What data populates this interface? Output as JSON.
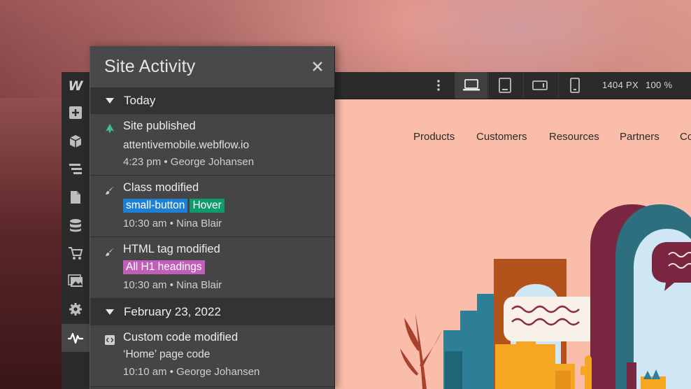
{
  "panel": {
    "title": "Site Activity",
    "sections": [
      {
        "label": "Today",
        "entries": [
          {
            "icon": "publish-icon",
            "title": "Site published",
            "detail": "attentivemobile.webflow.io",
            "meta": "4:23 pm • George Johansen"
          },
          {
            "icon": "brush-icon",
            "title": "Class modified",
            "tags": [
              {
                "text": "small-button",
                "color": "#1f7fd6"
              },
              {
                "text": "Hover",
                "color": "#0f9b6b"
              }
            ],
            "meta": "10:30 am • Nina Blair"
          },
          {
            "icon": "brush-icon",
            "title": "HTML tag modified",
            "tags": [
              {
                "text": "All H1 headings",
                "color": "#c05fb8"
              }
            ],
            "meta": "10:30 am • Nina Blair"
          }
        ]
      },
      {
        "label": "February 23, 2022",
        "entries": [
          {
            "icon": "code-icon",
            "title": "Custom code modified",
            "detail": "‘Home’ page code",
            "meta": "10:10 am • George Johansen"
          }
        ]
      }
    ]
  },
  "toolbar": {
    "width_readout": "1404 PX",
    "zoom_readout": "100 %"
  },
  "canvas": {
    "nav": [
      "Products",
      "Customers",
      "Resources",
      "Partners",
      "Co"
    ]
  },
  "rail": {
    "logo": "W",
    "items": [
      "add-icon",
      "cube-icon",
      "navigator-icon",
      "pages-icon",
      "cms-icon",
      "ecommerce-icon",
      "assets-icon",
      "settings-icon",
      "activity-icon"
    ]
  },
  "colors": {
    "canvas_bg": "#f9bda9",
    "publish_accent": "#3fbf8a",
    "tag_class": "#1f7fd6",
    "tag_state": "#0f9b6b",
    "tag_html": "#c05fb8"
  }
}
